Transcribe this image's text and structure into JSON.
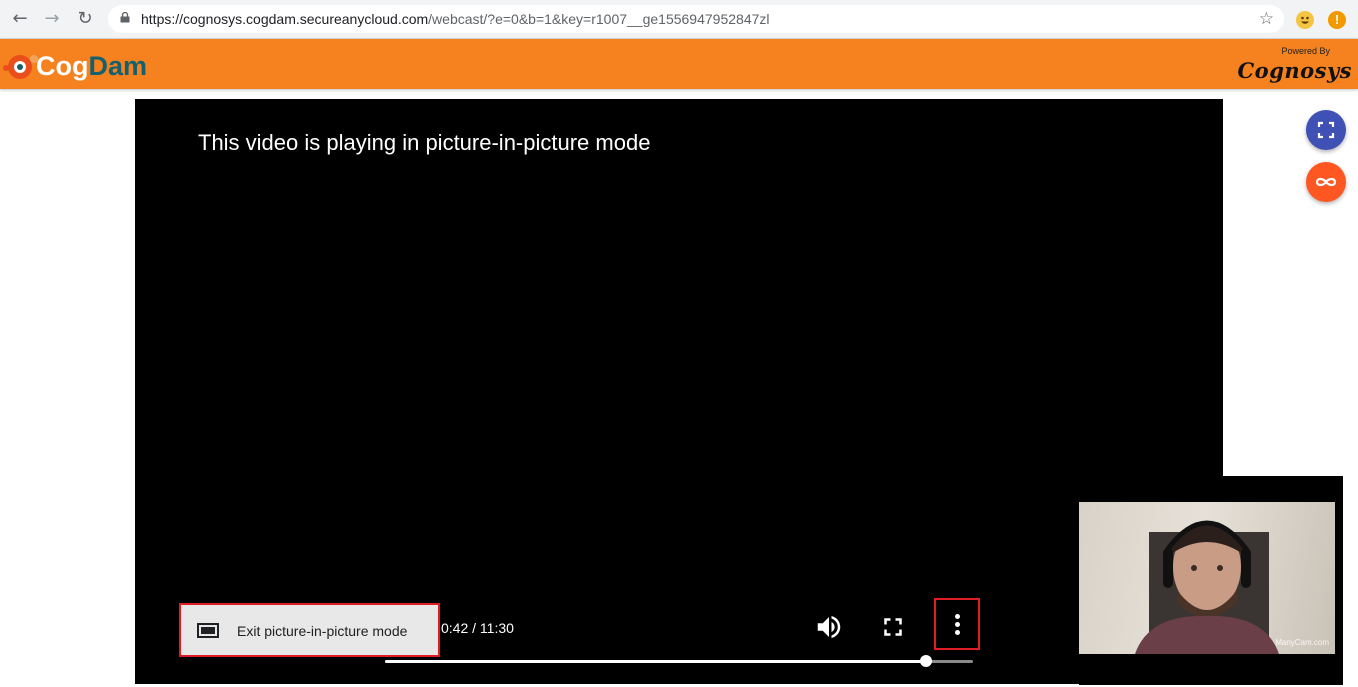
{
  "browser": {
    "url_host": "https://cognosys.cogdam.secureanycloud.com",
    "url_path": "/webcast/?e=0&b=1&key=r1007__ge1556947952847zl",
    "icons": [
      "back-arrow-icon",
      "forward-arrow-icon",
      "reload-icon",
      "lock-icon",
      "star-icon",
      "emoji-extension-icon",
      "warning-icon"
    ]
  },
  "header": {
    "logo_part1": "Cog",
    "logo_part2": "Dam",
    "powered_by": "Powered By",
    "brand": "Cognosys",
    "colors": {
      "bar": "#f5821f",
      "logo_dark": "#15606f"
    }
  },
  "video": {
    "pip_message": "This video is playing in picture-in-picture mode",
    "exit_pip_label": "Exit picture-in-picture mode",
    "time_display": "0:42 / 11:30",
    "progress_fraction": 0.92,
    "controls": [
      "exit-pip-icon",
      "volume-icon",
      "fullscreen-icon",
      "more-options-icon"
    ]
  },
  "side_buttons": [
    {
      "name": "fullscreen",
      "icon": "expand-icon",
      "color": "#3f51b5"
    },
    {
      "name": "loop",
      "icon": "infinity-icon",
      "color": "#ff5722"
    }
  ],
  "webcam": {
    "watermark": "ManyCam.com"
  }
}
